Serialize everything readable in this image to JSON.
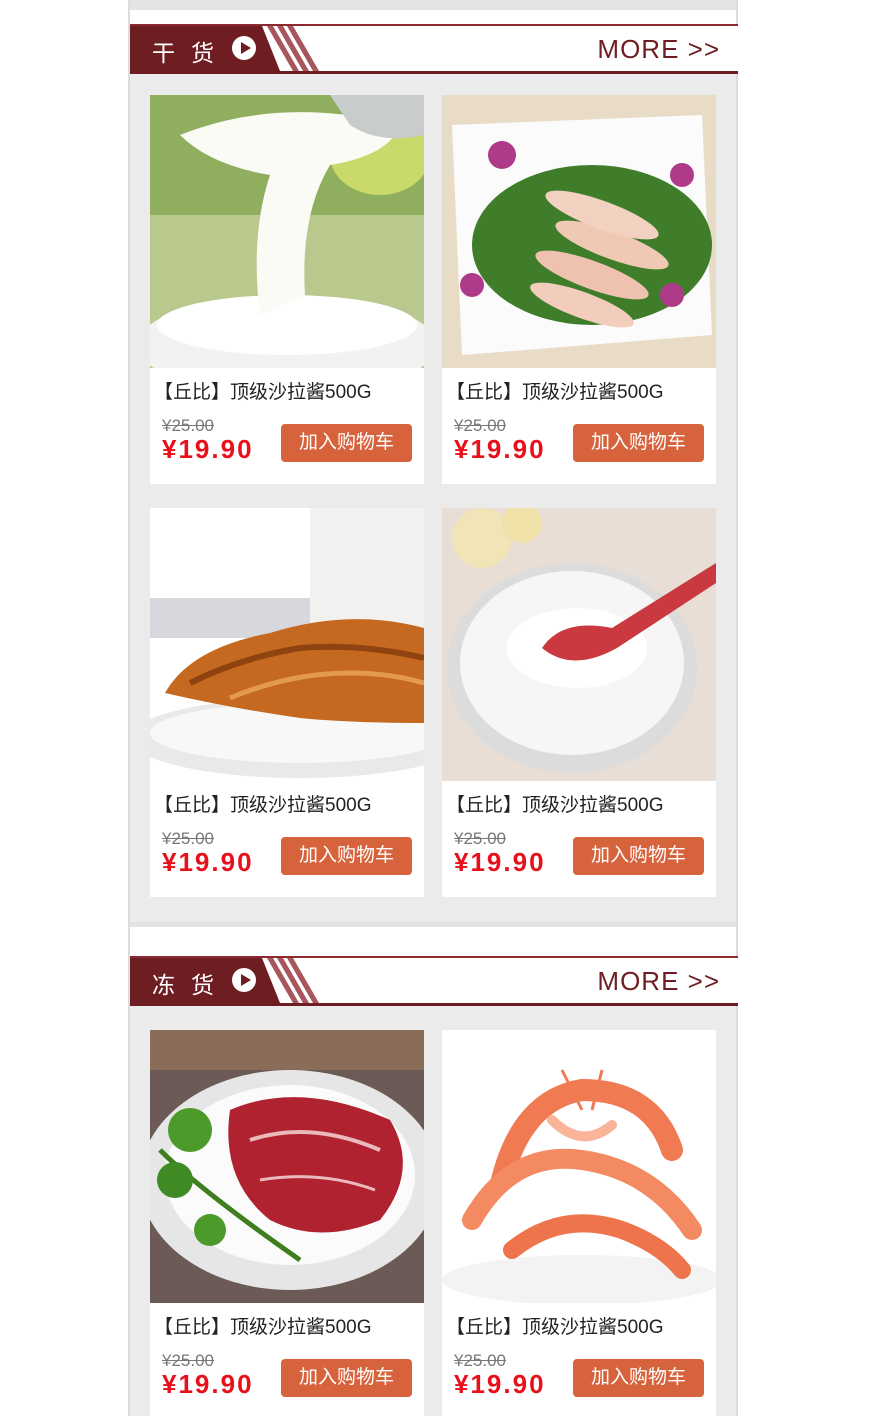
{
  "sections": [
    {
      "title": "干货",
      "more": "MORE >>",
      "products": [
        {
          "name": "【丘比】顶级沙拉酱500G",
          "old_price": "¥25.00",
          "price": "¥19.90",
          "button": "加入购物车"
        },
        {
          "name": "【丘比】顶级沙拉酱500G",
          "old_price": "¥25.00",
          "price": "¥19.90",
          "button": "加入购物车"
        },
        {
          "name": "【丘比】顶级沙拉酱500G",
          "old_price": "¥25.00",
          "price": "¥19.90",
          "button": "加入购物车"
        },
        {
          "name": "【丘比】顶级沙拉酱500G",
          "old_price": "¥25.00",
          "price": "¥19.90",
          "button": "加入购物车"
        }
      ]
    },
    {
      "title": "冻货",
      "more": "MORE >>",
      "products": [
        {
          "name": "【丘比】顶级沙拉酱500G",
          "old_price": "¥25.00",
          "price": "¥19.90",
          "button": "加入购物车"
        },
        {
          "name": "【丘比】顶级沙拉酱500G",
          "old_price": "¥25.00",
          "price": "¥19.90",
          "button": "加入购物车"
        }
      ]
    }
  ],
  "colors": {
    "brand": "#6e1d23",
    "price": "#e8101a",
    "button": "#d7633d",
    "background": "#ebebeb"
  }
}
